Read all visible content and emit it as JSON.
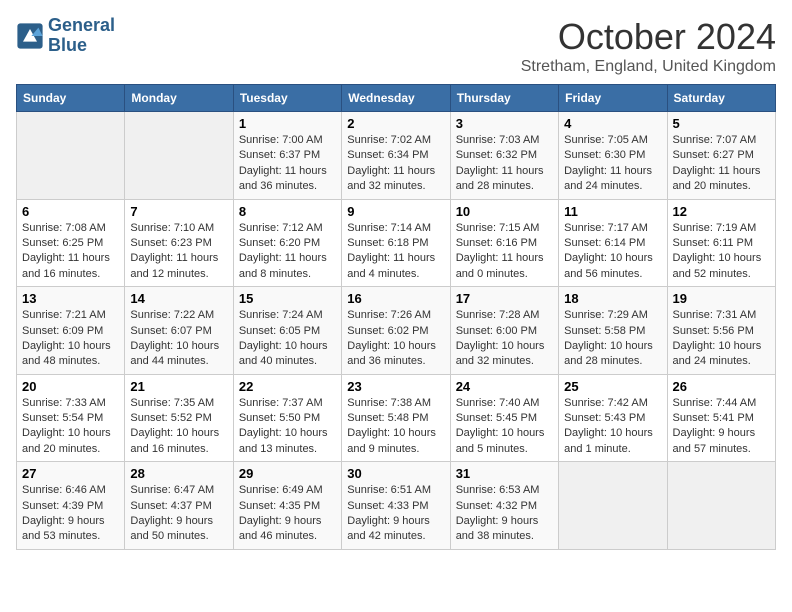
{
  "logo": {
    "line1": "General",
    "line2": "Blue"
  },
  "title": "October 2024",
  "location": "Stretham, England, United Kingdom",
  "days_of_week": [
    "Sunday",
    "Monday",
    "Tuesday",
    "Wednesday",
    "Thursday",
    "Friday",
    "Saturday"
  ],
  "weeks": [
    [
      {
        "day": "",
        "info": ""
      },
      {
        "day": "",
        "info": ""
      },
      {
        "day": "1",
        "info": "Sunrise: 7:00 AM\nSunset: 6:37 PM\nDaylight: 11 hours and 36 minutes."
      },
      {
        "day": "2",
        "info": "Sunrise: 7:02 AM\nSunset: 6:34 PM\nDaylight: 11 hours and 32 minutes."
      },
      {
        "day": "3",
        "info": "Sunrise: 7:03 AM\nSunset: 6:32 PM\nDaylight: 11 hours and 28 minutes."
      },
      {
        "day": "4",
        "info": "Sunrise: 7:05 AM\nSunset: 6:30 PM\nDaylight: 11 hours and 24 minutes."
      },
      {
        "day": "5",
        "info": "Sunrise: 7:07 AM\nSunset: 6:27 PM\nDaylight: 11 hours and 20 minutes."
      }
    ],
    [
      {
        "day": "6",
        "info": "Sunrise: 7:08 AM\nSunset: 6:25 PM\nDaylight: 11 hours and 16 minutes."
      },
      {
        "day": "7",
        "info": "Sunrise: 7:10 AM\nSunset: 6:23 PM\nDaylight: 11 hours and 12 minutes."
      },
      {
        "day": "8",
        "info": "Sunrise: 7:12 AM\nSunset: 6:20 PM\nDaylight: 11 hours and 8 minutes."
      },
      {
        "day": "9",
        "info": "Sunrise: 7:14 AM\nSunset: 6:18 PM\nDaylight: 11 hours and 4 minutes."
      },
      {
        "day": "10",
        "info": "Sunrise: 7:15 AM\nSunset: 6:16 PM\nDaylight: 11 hours and 0 minutes."
      },
      {
        "day": "11",
        "info": "Sunrise: 7:17 AM\nSunset: 6:14 PM\nDaylight: 10 hours and 56 minutes."
      },
      {
        "day": "12",
        "info": "Sunrise: 7:19 AM\nSunset: 6:11 PM\nDaylight: 10 hours and 52 minutes."
      }
    ],
    [
      {
        "day": "13",
        "info": "Sunrise: 7:21 AM\nSunset: 6:09 PM\nDaylight: 10 hours and 48 minutes."
      },
      {
        "day": "14",
        "info": "Sunrise: 7:22 AM\nSunset: 6:07 PM\nDaylight: 10 hours and 44 minutes."
      },
      {
        "day": "15",
        "info": "Sunrise: 7:24 AM\nSunset: 6:05 PM\nDaylight: 10 hours and 40 minutes."
      },
      {
        "day": "16",
        "info": "Sunrise: 7:26 AM\nSunset: 6:02 PM\nDaylight: 10 hours and 36 minutes."
      },
      {
        "day": "17",
        "info": "Sunrise: 7:28 AM\nSunset: 6:00 PM\nDaylight: 10 hours and 32 minutes."
      },
      {
        "day": "18",
        "info": "Sunrise: 7:29 AM\nSunset: 5:58 PM\nDaylight: 10 hours and 28 minutes."
      },
      {
        "day": "19",
        "info": "Sunrise: 7:31 AM\nSunset: 5:56 PM\nDaylight: 10 hours and 24 minutes."
      }
    ],
    [
      {
        "day": "20",
        "info": "Sunrise: 7:33 AM\nSunset: 5:54 PM\nDaylight: 10 hours and 20 minutes."
      },
      {
        "day": "21",
        "info": "Sunrise: 7:35 AM\nSunset: 5:52 PM\nDaylight: 10 hours and 16 minutes."
      },
      {
        "day": "22",
        "info": "Sunrise: 7:37 AM\nSunset: 5:50 PM\nDaylight: 10 hours and 13 minutes."
      },
      {
        "day": "23",
        "info": "Sunrise: 7:38 AM\nSunset: 5:48 PM\nDaylight: 10 hours and 9 minutes."
      },
      {
        "day": "24",
        "info": "Sunrise: 7:40 AM\nSunset: 5:45 PM\nDaylight: 10 hours and 5 minutes."
      },
      {
        "day": "25",
        "info": "Sunrise: 7:42 AM\nSunset: 5:43 PM\nDaylight: 10 hours and 1 minute."
      },
      {
        "day": "26",
        "info": "Sunrise: 7:44 AM\nSunset: 5:41 PM\nDaylight: 9 hours and 57 minutes."
      }
    ],
    [
      {
        "day": "27",
        "info": "Sunrise: 6:46 AM\nSunset: 4:39 PM\nDaylight: 9 hours and 53 minutes."
      },
      {
        "day": "28",
        "info": "Sunrise: 6:47 AM\nSunset: 4:37 PM\nDaylight: 9 hours and 50 minutes."
      },
      {
        "day": "29",
        "info": "Sunrise: 6:49 AM\nSunset: 4:35 PM\nDaylight: 9 hours and 46 minutes."
      },
      {
        "day": "30",
        "info": "Sunrise: 6:51 AM\nSunset: 4:33 PM\nDaylight: 9 hours and 42 minutes."
      },
      {
        "day": "31",
        "info": "Sunrise: 6:53 AM\nSunset: 4:32 PM\nDaylight: 9 hours and 38 minutes."
      },
      {
        "day": "",
        "info": ""
      },
      {
        "day": "",
        "info": ""
      }
    ]
  ]
}
